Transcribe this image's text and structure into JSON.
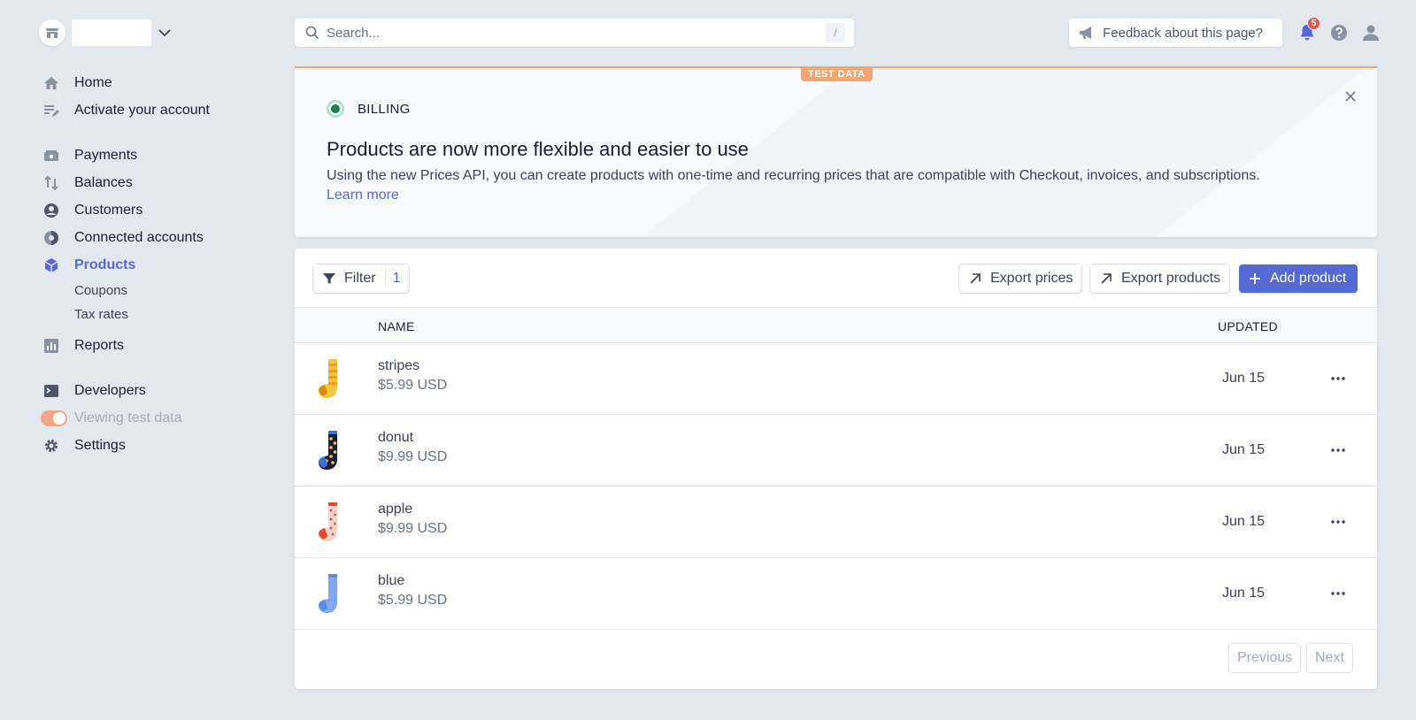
{
  "account": {
    "avatar_icon": "store-icon",
    "dropdown_icon": "chevron-down-icon"
  },
  "search": {
    "placeholder": "Search...",
    "shortcut": "/"
  },
  "header": {
    "feedback_label": "Feedback about this page?",
    "notifications_count": "5",
    "icons": [
      "megaphone-icon",
      "bell-icon",
      "help-icon",
      "user-icon"
    ]
  },
  "sidebar": {
    "items": [
      {
        "label": "Home",
        "icon": "home-icon"
      },
      {
        "label": "Activate your account",
        "icon": "activate-icon"
      },
      {
        "label": "Payments",
        "icon": "payments-icon"
      },
      {
        "label": "Balances",
        "icon": "balances-icon"
      },
      {
        "label": "Customers",
        "icon": "customers-icon"
      },
      {
        "label": "Connected accounts",
        "icon": "connected-accounts-icon"
      },
      {
        "label": "Products",
        "icon": "products-icon",
        "active": true
      },
      {
        "label": "Coupons"
      },
      {
        "label": "Tax rates"
      },
      {
        "label": "Reports",
        "icon": "reports-icon"
      },
      {
        "label": "Developers",
        "icon": "developers-icon"
      },
      {
        "label": "Viewing test data",
        "toggle_on": true
      },
      {
        "label": "Settings",
        "icon": "gear-icon"
      }
    ]
  },
  "banner": {
    "tag": "TEST DATA",
    "label": "BILLING",
    "title": "Products are now more flexible and easier to use",
    "text": "Using the new Prices API, you can create products with one-time and recurring prices that are compatible with Checkout, invoices, and subscriptions.",
    "link": "Learn more"
  },
  "toolbar": {
    "filter_label": "Filter",
    "filter_count": "1",
    "export_prices": "Export prices",
    "export_products": "Export products",
    "add_product": "Add product"
  },
  "table": {
    "columns": [
      "NAME",
      "UPDATED"
    ],
    "rows": [
      {
        "name": "stripes",
        "price": "$5.99 USD",
        "updated": "Jun 15",
        "thumb": "stripes-sock"
      },
      {
        "name": "donut",
        "price": "$9.99 USD",
        "updated": "Jun 15",
        "thumb": "donut-sock"
      },
      {
        "name": "apple",
        "price": "$9.99 USD",
        "updated": "Jun 15",
        "thumb": "apple-sock"
      },
      {
        "name": "blue",
        "price": "$5.99 USD",
        "updated": "Jun 15",
        "thumb": "blue-sock"
      }
    ]
  },
  "pagination": {
    "previous": "Previous",
    "next": "Next"
  },
  "colors": {
    "accent": "#5469d4",
    "test": "#f5a56f",
    "background": "#e3e8ee"
  }
}
